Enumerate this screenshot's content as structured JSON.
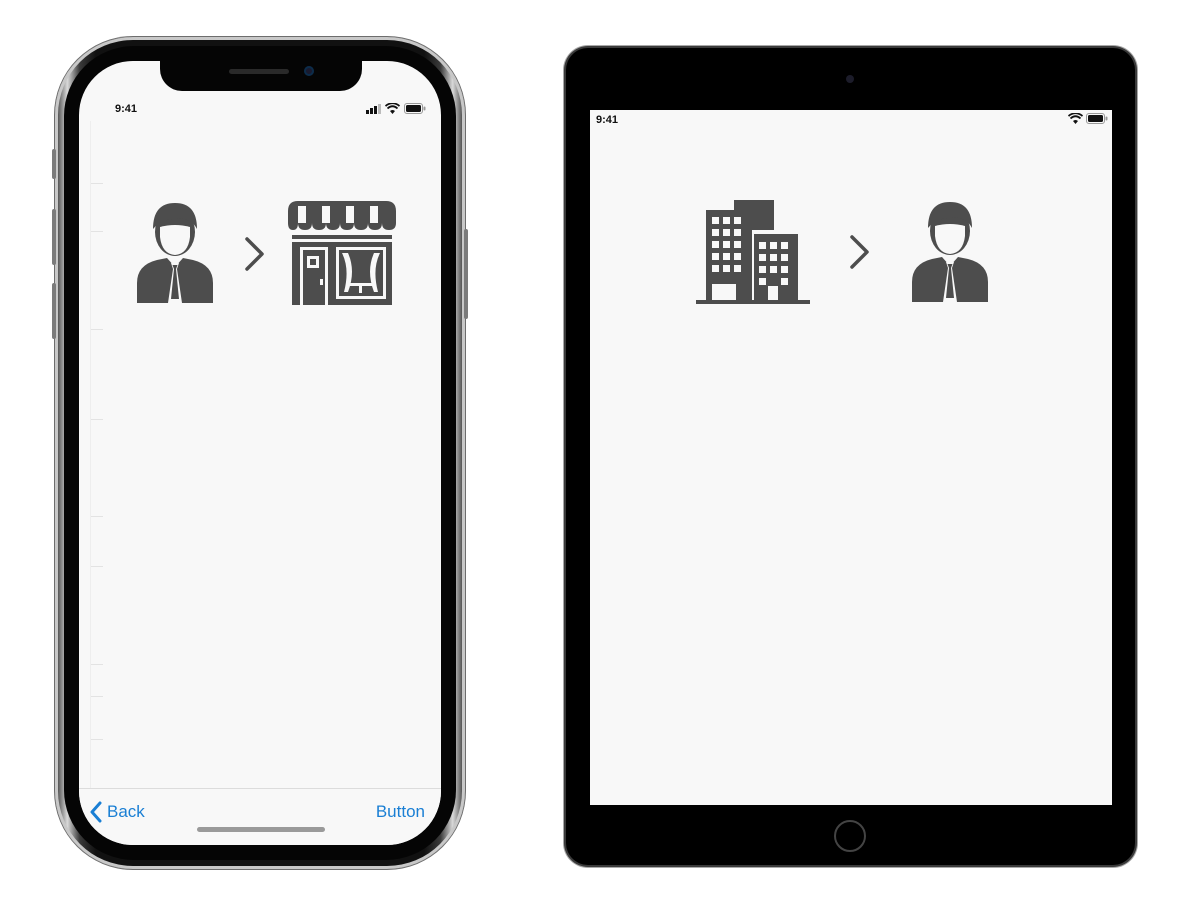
{
  "phone": {
    "status_time": "9:41",
    "toolbar": {
      "back_label": "Back",
      "right_label": "Button"
    },
    "icons": [
      "person-icon",
      "chevron-right-icon",
      "store-icon"
    ]
  },
  "tablet": {
    "status_time": "9:41",
    "icons": [
      "office-building-icon",
      "chevron-right-icon",
      "person-icon"
    ]
  },
  "colors": {
    "icon_gray": "#4d4d4d",
    "tint_blue": "#1a7fd4",
    "screen_bg": "#f8f8f8"
  }
}
